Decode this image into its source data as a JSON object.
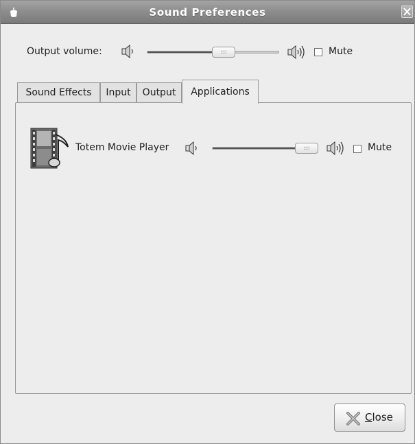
{
  "window": {
    "title": "Sound Preferences"
  },
  "output": {
    "label": "Output volume:",
    "volume_level": 0.6,
    "mute_label": "Mute",
    "muted": false
  },
  "tabs": [
    {
      "label": "Sound Effects",
      "active": false
    },
    {
      "label": "Input",
      "active": false
    },
    {
      "label": "Output",
      "active": false
    },
    {
      "label": "Applications",
      "active": true
    }
  ],
  "applications": [
    {
      "name": "Totem Movie Player",
      "icon": "film-music-icon",
      "volume_level": 1.0,
      "mute_label": "Mute",
      "muted": false
    }
  ],
  "footer": {
    "close_mnemonic": "C",
    "close_rest": "lose"
  },
  "icons": {
    "menu": "window-menu-icon",
    "close": "close-icon",
    "speaker_low": "speaker-low-icon",
    "speaker_high": "speaker-high-icon"
  },
  "colors": {
    "titlebar": "#8e8e8e",
    "window_bg": "#ededed",
    "slider_fill": "#555555"
  }
}
